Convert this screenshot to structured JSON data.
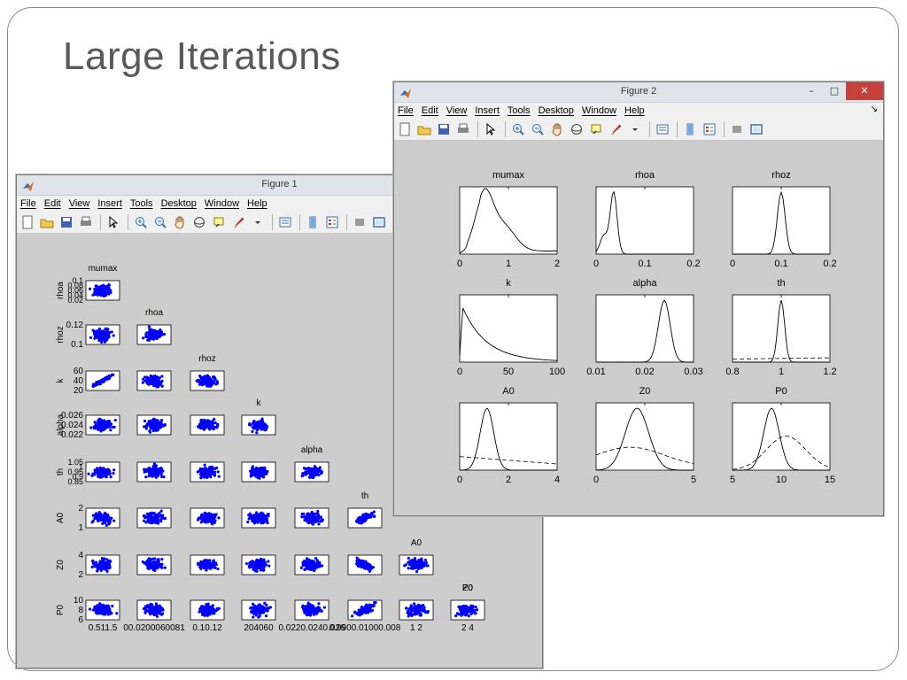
{
  "slide": {
    "title": "Large Iterations"
  },
  "figure1": {
    "window_title": "Figure 1",
    "menu": [
      "File",
      "Edit",
      "View",
      "Insert",
      "Tools",
      "Desktop",
      "Window",
      "Help"
    ],
    "params": [
      "mumax",
      "rhoa",
      "rhoz",
      "k",
      "alpha",
      "th",
      "A0",
      "Z0",
      "P0"
    ],
    "row_ticks": [
      [
        "0.1",
        "0.08",
        "0.06",
        "0.04",
        "0.02"
      ],
      [
        "0.12",
        "0.1"
      ],
      [
        "60",
        "40",
        "20"
      ],
      [
        "0.026",
        "0.024",
        "0.022"
      ],
      [
        "1.05",
        "1",
        "0.95",
        "0.9",
        "0.85"
      ],
      [
        "2",
        "1"
      ],
      [
        "4",
        "2"
      ],
      [
        "10",
        "8",
        "6"
      ]
    ],
    "col_ticks": [
      "0.511.5",
      "00.0200060081",
      "0.10.12",
      "204060",
      "0.0220.0240.026",
      "0.9900.01000.008",
      "1  2",
      "2  4"
    ],
    "marker_color": "#0000ff"
  },
  "figure2": {
    "window_title": "Figure 2",
    "menu": [
      "File",
      "Edit",
      "View",
      "Insert",
      "Tools",
      "Desktop",
      "Window",
      "Help"
    ],
    "panels": [
      {
        "title": "mumax",
        "ticks": [
          "0",
          "1",
          "2"
        ]
      },
      {
        "title": "rhoa",
        "ticks": [
          "0",
          "0.1",
          "0.2"
        ]
      },
      {
        "title": "rhoz",
        "ticks": [
          "0",
          "0.1",
          "0.2"
        ]
      },
      {
        "title": "k",
        "ticks": [
          "0",
          "50",
          "100"
        ]
      },
      {
        "title": "alpha",
        "ticks": [
          "0.01",
          "0.02",
          "0.03"
        ]
      },
      {
        "title": "th",
        "ticks": [
          "0.8",
          "1",
          "1.2"
        ]
      },
      {
        "title": "A0",
        "ticks": [
          "0",
          "2",
          "4"
        ]
      },
      {
        "title": "Z0",
        "ticks": [
          "0",
          "5"
        ]
      },
      {
        "title": "P0",
        "ticks": [
          "5",
          "10",
          "15"
        ]
      }
    ]
  },
  "colors": {
    "close_button": "#c7413a",
    "figure_background": "#cdcdcd",
    "titlebar": "#dfe4ea"
  }
}
